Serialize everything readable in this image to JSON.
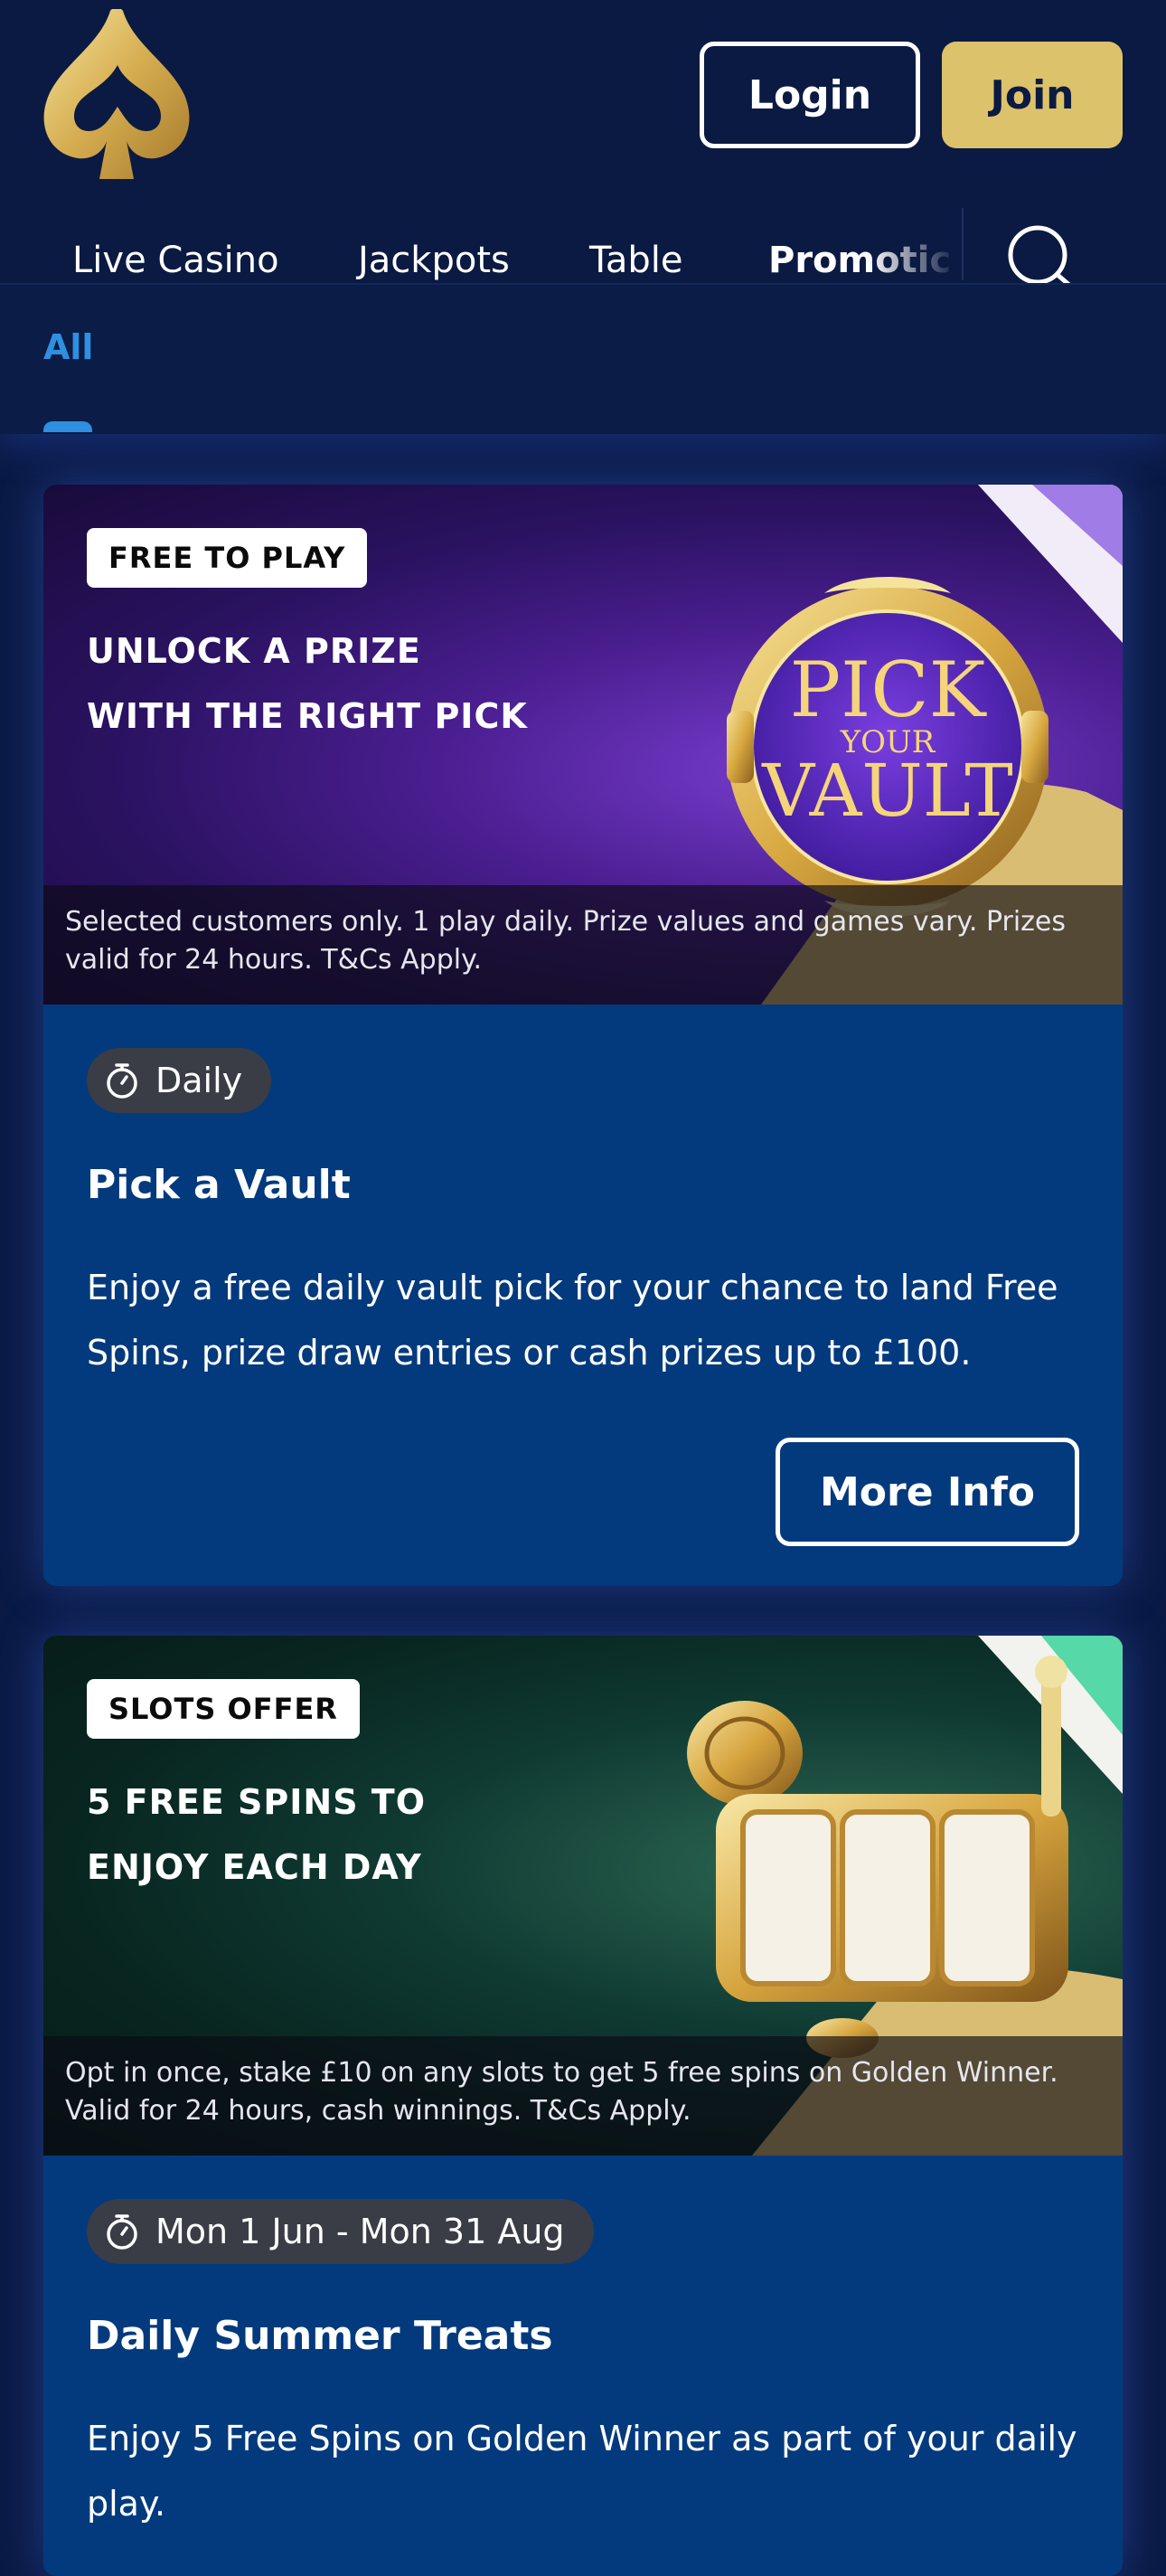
{
  "header": {
    "login_label": "Login",
    "join_label": "Join"
  },
  "nav": {
    "items": [
      {
        "label": "Live Casino"
      },
      {
        "label": "Jackpots"
      },
      {
        "label": "Table"
      },
      {
        "label": "Promotic"
      }
    ],
    "active_index": 3
  },
  "subnav": {
    "active_label": "All"
  },
  "promotions": [
    {
      "tag": "FREE TO PLAY",
      "headline_line1": "UNLOCK A PRIZE",
      "headline_line2": "WITH THE RIGHT PICK",
      "art_word_top": "PICK",
      "art_word_mid": "YOUR",
      "art_word_bottom": "VAULT",
      "terms": "Selected customers only. 1 play daily. Prize values and games vary. Prizes valid for 24 hours. T&Cs Apply.",
      "date": "Daily",
      "title": "Pick a Vault",
      "description": "Enjoy a free daily vault pick for your chance to land Free Spins, prize draw entries or cash prizes up to £100.",
      "button_label": "More Info"
    },
    {
      "tag": "SLOTS OFFER",
      "headline_line1": "5 FREE SPINS TO",
      "headline_line2": "ENJOY EACH DAY",
      "terms": "Opt in once, stake £10 on any slots to get 5 free spins on Golden Winner. Valid for 24 hours, cash winnings. T&Cs Apply.",
      "date": "Mon 1 Jun - Mon 31 Aug",
      "title": "Daily Summer Treats",
      "description": "Enjoy 5 Free Spins on Golden Winner as part of your daily play."
    }
  ],
  "colors": {
    "page_bg": "#0a1a45",
    "card_bg": "#033a7d",
    "gold": "#dcc26a",
    "accent_blue": "#2f8fe0"
  }
}
